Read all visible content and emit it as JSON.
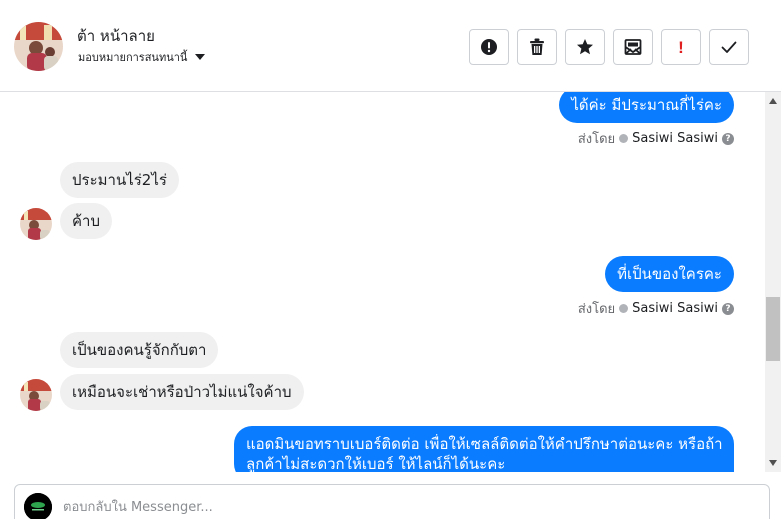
{
  "header": {
    "contact_name": "ต้า หน้าลาย",
    "assign_label": "มอบหมายการสนทนานี้",
    "toolbar": [
      {
        "name": "spam-button",
        "icon": "exclamation-circle-icon"
      },
      {
        "name": "delete-button",
        "icon": "trash-icon"
      },
      {
        "name": "star-button",
        "icon": "star-icon"
      },
      {
        "name": "mark-unread-button",
        "icon": "envelope-icon"
      },
      {
        "name": "follow-up-button",
        "icon": "exclamation-icon",
        "text": "!"
      },
      {
        "name": "done-button",
        "icon": "check-icon"
      }
    ]
  },
  "messages": [
    {
      "dir": "out",
      "text": "ได้ค่ะ มีประมาณกี่ไร่คะ"
    },
    {
      "sent_by_label": "ส่งโดย",
      "sent_by_name": "Sasiwi Sasiwi",
      "help": "?"
    },
    {
      "dir": "in",
      "text": "ประมานไร่2ไร่"
    },
    {
      "dir": "in",
      "text": "ค้าบ"
    },
    {
      "dir": "out",
      "text": "ที่เป็นของใครคะ"
    },
    {
      "sent_by_label": "ส่งโดย",
      "sent_by_name": "Sasiwi Sasiwi",
      "help": "?"
    },
    {
      "dir": "in",
      "text": "เป็นของคนรู้จักกับตา"
    },
    {
      "dir": "in",
      "text": "เหมือนจะเช่าหรือป่าวไม่แน่ใจค้าบ"
    },
    {
      "dir": "out",
      "line1": "แอดมินขอทราบเบอร์ติดต่อ เพื่อให้เซลล์ติดต่อให้คำปรึกษาต่อนะคะ หรือถ้า",
      "line2": "ลูกค้าไม่สะดวกให้เบอร์ ให้ไลน์ก็ได้นะคะ"
    }
  ],
  "composer": {
    "placeholder": "ตอบกลับใน Messenger..."
  },
  "colors": {
    "outgoing_bubble": "#0a7cff",
    "incoming_bubble": "#f0f0f0",
    "follow_up_red": "#e02020"
  }
}
